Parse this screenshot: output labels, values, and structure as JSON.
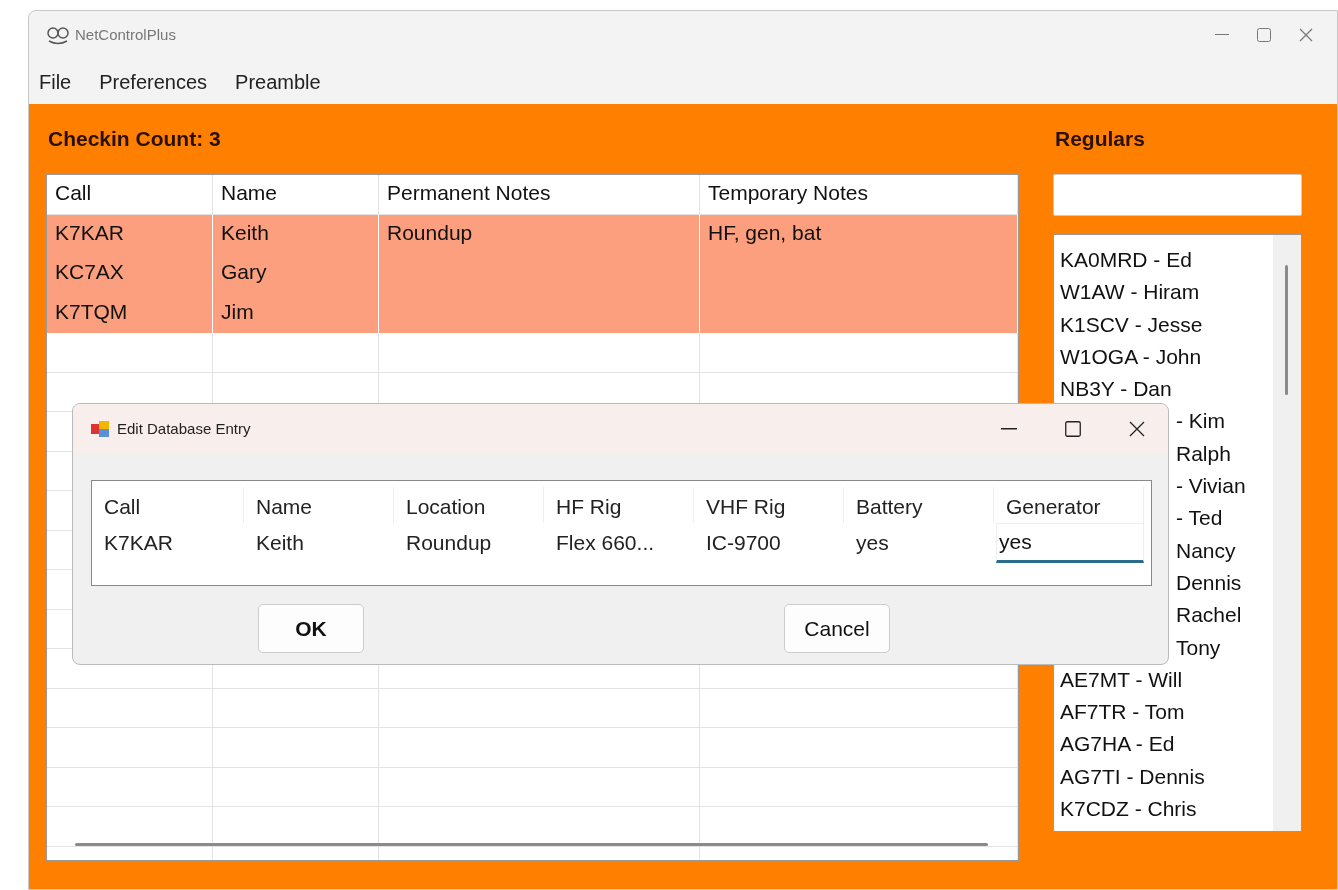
{
  "window": {
    "title": "NetControlPlus"
  },
  "menu": [
    {
      "label": "File"
    },
    {
      "label": "Preferences"
    },
    {
      "label": "Preamble"
    }
  ],
  "checkin_count": "Checkin Count: 3",
  "checkins": {
    "columns": [
      "Call",
      "Name",
      "Permanent Notes",
      "Temporary Notes"
    ],
    "rows": [
      {
        "cells": [
          "K7KAR",
          "Keith",
          "Roundup",
          "HF, gen, bat"
        ],
        "highlighted": true
      },
      {
        "cells": [
          "KC7AX",
          "Gary",
          "",
          ""
        ],
        "highlighted": true
      },
      {
        "cells": [
          "K7TQM",
          "Jim",
          "",
          ""
        ],
        "highlighted": true
      }
    ]
  },
  "regulars": {
    "title": "Regulars",
    "items": [
      {
        "text": "KA0MRD - Ed",
        "kind": "full"
      },
      {
        "text": "W1AW - Hiram",
        "kind": "full"
      },
      {
        "text": "K1SCV - Jesse",
        "kind": "full"
      },
      {
        "text": "W1OGA - John",
        "kind": "full"
      },
      {
        "text": "NB3Y - Dan",
        "kind": "full"
      },
      {
        "text": "- Kim",
        "kind": "partial"
      },
      {
        "text": "Ralph",
        "kind": "partial"
      },
      {
        "text": "- Vivian",
        "kind": "partial"
      },
      {
        "text": "- Ted",
        "kind": "partial"
      },
      {
        "text": "Nancy",
        "kind": "partial"
      },
      {
        "text": "Dennis",
        "kind": "partial"
      },
      {
        "text": "Rachel",
        "kind": "partial"
      },
      {
        "text": "Tony",
        "kind": "partial"
      },
      {
        "text": "AE7MT - Will",
        "kind": "full"
      },
      {
        "text": "AF7TR - Tom",
        "kind": "full"
      },
      {
        "text": "AG7HA - Ed",
        "kind": "full"
      },
      {
        "text": "AG7TI - Dennis",
        "kind": "full"
      },
      {
        "text": "K7CDZ - Chris",
        "kind": "full"
      }
    ]
  },
  "dialog": {
    "title": "Edit Database Entry",
    "fields": [
      {
        "label": "Call",
        "value": "K7KAR",
        "editing": false
      },
      {
        "label": "Name",
        "value": "Keith",
        "editing": false
      },
      {
        "label": "Location",
        "value": "Roundup",
        "editing": false
      },
      {
        "label": "HF Rig",
        "value": "Flex 660...",
        "editing": false
      },
      {
        "label": "VHF Rig",
        "value": "IC-9700",
        "editing": false
      },
      {
        "label": "Battery",
        "value": "yes",
        "editing": false
      },
      {
        "label": "Generator",
        "value": "yes",
        "editing": true
      }
    ],
    "buttons": [
      {
        "label": "OK",
        "default": true
      },
      {
        "label": "Cancel",
        "default": false
      }
    ]
  }
}
